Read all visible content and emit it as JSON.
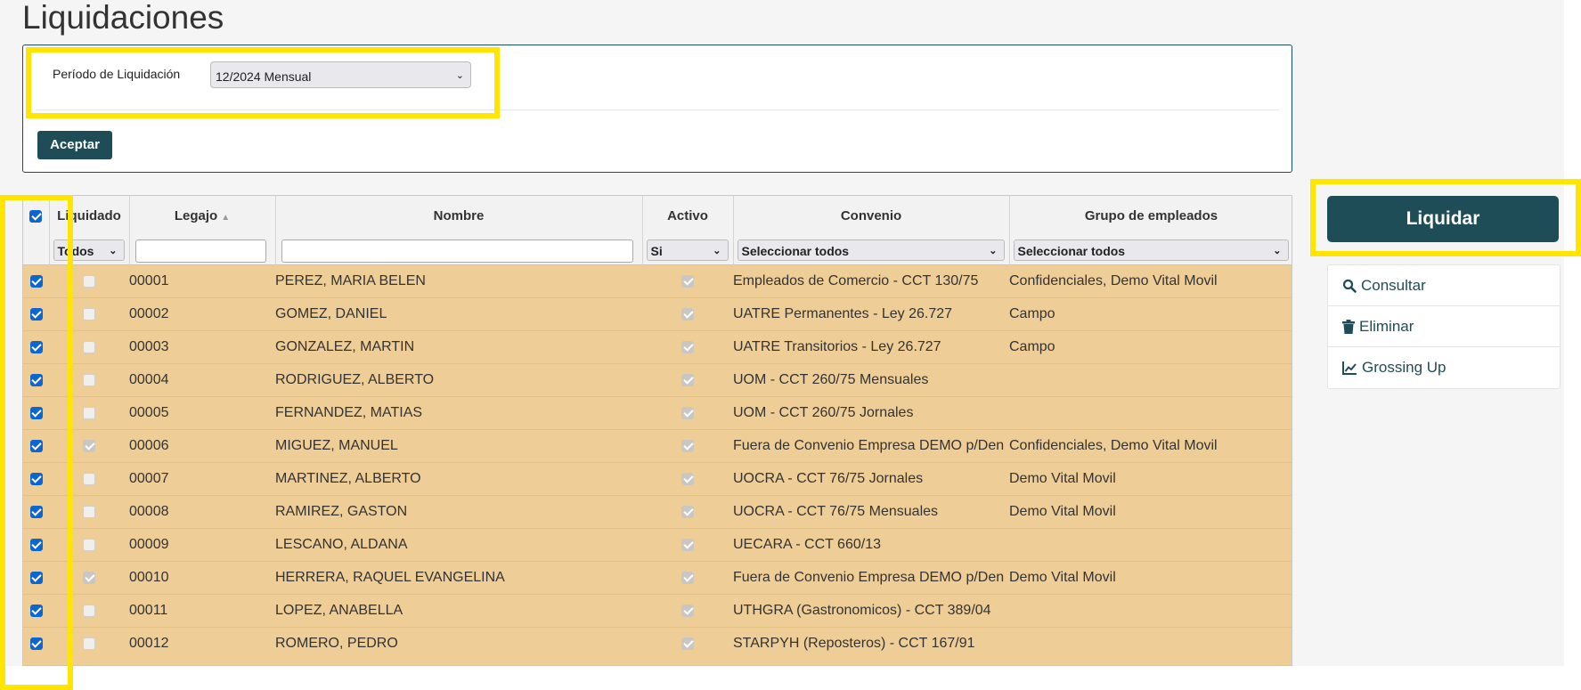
{
  "page": {
    "title": "Liquidaciones"
  },
  "filter": {
    "period_label": "Período de Liquidación",
    "period_value": "12/2024 Mensual",
    "accept_label": "Aceptar"
  },
  "table": {
    "headers": {
      "liquidado": "Liquidado",
      "legajo": "Legajo",
      "nombre": "Nombre",
      "activo": "Activo",
      "convenio": "Convenio",
      "grupo": "Grupo de empleados"
    },
    "filters": {
      "liquidado": "Todos",
      "activo": "Si",
      "convenio": "Seleccionar todos",
      "grupo": "Seleccionar todos"
    },
    "select_all_checked": true,
    "rows": [
      {
        "selected": true,
        "liquidado": false,
        "legajo": "00001",
        "nombre": "PEREZ, MARIA BELEN",
        "activo": true,
        "convenio": "Empleados de Comercio - CCT 130/75",
        "grupo": "Confidenciales, Demo Vital Movil"
      },
      {
        "selected": true,
        "liquidado": false,
        "legajo": "00002",
        "nombre": "GOMEZ, DANIEL",
        "activo": true,
        "convenio": "UATRE Permanentes - Ley 26.727",
        "grupo": "Campo"
      },
      {
        "selected": true,
        "liquidado": false,
        "legajo": "00003",
        "nombre": "GONZALEZ, MARTIN",
        "activo": true,
        "convenio": "UATRE Transitorios - Ley 26.727",
        "grupo": "Campo"
      },
      {
        "selected": true,
        "liquidado": false,
        "legajo": "00004",
        "nombre": "RODRIGUEZ, ALBERTO",
        "activo": true,
        "convenio": "UOM - CCT 260/75 Mensuales",
        "grupo": ""
      },
      {
        "selected": true,
        "liquidado": false,
        "legajo": "00005",
        "nombre": "FERNANDEZ, MATIAS",
        "activo": true,
        "convenio": "UOM - CCT 260/75 Jornales",
        "grupo": ""
      },
      {
        "selected": true,
        "liquidado": true,
        "legajo": "00006",
        "nombre": "MIGUEZ, MANUEL",
        "activo": true,
        "convenio": "Fuera de Convenio Empresa DEMO p/Den",
        "grupo": "Confidenciales, Demo Vital Movil"
      },
      {
        "selected": true,
        "liquidado": false,
        "legajo": "00007",
        "nombre": "MARTINEZ, ALBERTO",
        "activo": true,
        "convenio": "UOCRA - CCT 76/75 Jornales",
        "grupo": "Demo Vital Movil"
      },
      {
        "selected": true,
        "liquidado": false,
        "legajo": "00008",
        "nombre": "RAMIREZ, GASTON",
        "activo": true,
        "convenio": "UOCRA - CCT 76/75 Mensuales",
        "grupo": "Demo Vital Movil"
      },
      {
        "selected": true,
        "liquidado": false,
        "legajo": "00009",
        "nombre": "LESCANO, ALDANA",
        "activo": true,
        "convenio": "UECARA - CCT 660/13",
        "grupo": ""
      },
      {
        "selected": true,
        "liquidado": true,
        "legajo": "00010",
        "nombre": "HERRERA, RAQUEL EVANGELINA",
        "activo": true,
        "convenio": "Fuera de Convenio Empresa DEMO p/Den",
        "grupo": "Demo Vital Movil"
      },
      {
        "selected": true,
        "liquidado": false,
        "legajo": "00011",
        "nombre": "LOPEZ, ANABELLA",
        "activo": true,
        "convenio": "UTHGRA (Gastronomicos) - CCT 389/04",
        "grupo": ""
      },
      {
        "selected": true,
        "liquidado": false,
        "legajo": "00012",
        "nombre": "ROMERO, PEDRO",
        "activo": true,
        "convenio": "STARPYH (Reposteros) - CCT 167/91",
        "grupo": ""
      }
    ]
  },
  "actions": {
    "liquidar": "Liquidar",
    "items": [
      {
        "label": "Consultar",
        "icon": "search-icon"
      },
      {
        "label": "Eliminar",
        "icon": "trash-icon"
      },
      {
        "label": "Grossing Up",
        "icon": "chart-line-icon"
      }
    ]
  },
  "colors": {
    "accent": "#1e4d57",
    "row_bg": "#efcd96",
    "highlight": "#ffe500"
  }
}
